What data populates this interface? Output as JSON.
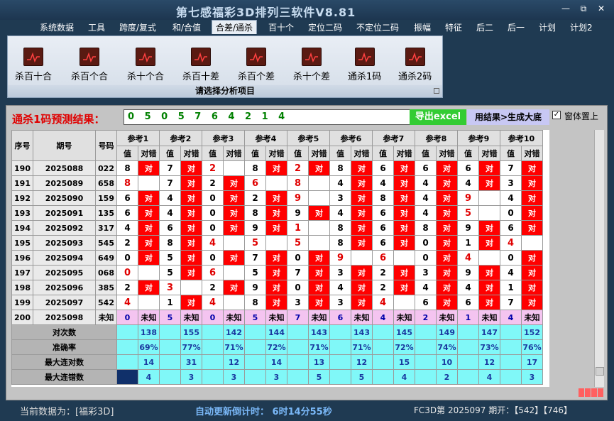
{
  "window": {
    "title": "第七感福彩3D排列三软件V8.81",
    "minimize": "—",
    "restore": "⧉",
    "close": "✕"
  },
  "menu": [
    "系统数据",
    "工具",
    "跨度/复式",
    "和/合值",
    "合差/通杀",
    "百十个",
    "定位二码",
    "不定位二码",
    "振幅",
    "特征",
    "后二",
    "后一",
    "计划",
    "计划2"
  ],
  "menu_active": 4,
  "ribbon": {
    "buttons": [
      "杀百十合",
      "杀百个合",
      "杀十个合",
      "杀百十差",
      "杀百个差",
      "杀十个差",
      "通杀1码",
      "通杀2码"
    ],
    "icon": "chart-icon",
    "caption": "请选择分析项目"
  },
  "prediction": {
    "label": "通杀1码预测结果：",
    "value": "0 5 0 5 7 6 4 2 1 4"
  },
  "buttons": {
    "export": "导出excel",
    "generate": "用结果>生成大底",
    "on_top": "窗体置上",
    "on_top_checked": "✓"
  },
  "table": {
    "head_seq": "序号",
    "head_period": "期号",
    "head_number": "号码",
    "refs": [
      "参考1",
      "参考2",
      "参考3",
      "参考4",
      "参考5",
      "参考6",
      "参考7",
      "参考8",
      "参考9",
      "参考10"
    ],
    "sub_value": "值",
    "sub_hit": "对错",
    "hit_word": "对",
    "rows": [
      {
        "seq": "190",
        "period": "2025088",
        "num": "022",
        "vals": [
          "8",
          "7",
          "2",
          "8",
          "2",
          "8",
          "6",
          "6",
          "6",
          "7"
        ],
        "hits": [
          1,
          1,
          0,
          1,
          1,
          1,
          1,
          1,
          1,
          1
        ],
        "red": [
          0,
          0,
          1,
          0,
          1,
          0,
          0,
          0,
          0,
          0
        ]
      },
      {
        "seq": "191",
        "period": "2025089",
        "num": "658",
        "vals": [
          "8",
          "7",
          "2",
          "6",
          "8",
          "4",
          "4",
          "4",
          "4",
          "3"
        ],
        "hits": [
          0,
          1,
          1,
          0,
          0,
          1,
          1,
          1,
          1,
          1
        ],
        "red": [
          1,
          0,
          0,
          1,
          1,
          0,
          0,
          0,
          0,
          0
        ]
      },
      {
        "seq": "192",
        "period": "2025090",
        "num": "159",
        "vals": [
          "6",
          "4",
          "0",
          "2",
          "9",
          "3",
          "8",
          "4",
          "9",
          "4"
        ],
        "hits": [
          1,
          1,
          1,
          1,
          0,
          1,
          1,
          1,
          0,
          1
        ],
        "red": [
          0,
          0,
          0,
          0,
          1,
          0,
          0,
          0,
          1,
          0
        ]
      },
      {
        "seq": "193",
        "period": "2025091",
        "num": "135",
        "vals": [
          "6",
          "4",
          "0",
          "8",
          "9",
          "4",
          "6",
          "4",
          "5",
          "0"
        ],
        "hits": [
          1,
          1,
          1,
          1,
          1,
          1,
          1,
          1,
          0,
          1
        ],
        "red": [
          0,
          0,
          0,
          0,
          0,
          0,
          0,
          0,
          1,
          0
        ]
      },
      {
        "seq": "194",
        "period": "2025092",
        "num": "317",
        "vals": [
          "4",
          "6",
          "0",
          "9",
          "1",
          "8",
          "6",
          "8",
          "9",
          "6"
        ],
        "hits": [
          1,
          1,
          1,
          1,
          0,
          1,
          1,
          1,
          1,
          1
        ],
        "red": [
          0,
          0,
          0,
          0,
          1,
          0,
          0,
          0,
          0,
          0
        ]
      },
      {
        "seq": "195",
        "period": "2025093",
        "num": "545",
        "vals": [
          "2",
          "8",
          "4",
          "5",
          "5",
          "8",
          "6",
          "0",
          "1",
          "4"
        ],
        "hits": [
          1,
          1,
          0,
          0,
          0,
          1,
          1,
          1,
          1,
          0
        ],
        "red": [
          0,
          0,
          1,
          1,
          1,
          0,
          0,
          0,
          0,
          1
        ]
      },
      {
        "seq": "196",
        "period": "2025094",
        "num": "649",
        "vals": [
          "0",
          "5",
          "0",
          "7",
          "0",
          "9",
          "6",
          "0",
          "4",
          "0"
        ],
        "hits": [
          1,
          1,
          1,
          1,
          1,
          0,
          0,
          1,
          0,
          1
        ],
        "red": [
          0,
          0,
          0,
          0,
          0,
          1,
          1,
          0,
          1,
          0
        ]
      },
      {
        "seq": "197",
        "period": "2025095",
        "num": "068",
        "vals": [
          "0",
          "5",
          "6",
          "5",
          "7",
          "3",
          "2",
          "3",
          "9",
          "4"
        ],
        "hits": [
          0,
          1,
          0,
          1,
          1,
          1,
          1,
          1,
          1,
          1
        ],
        "red": [
          1,
          0,
          1,
          0,
          0,
          0,
          0,
          0,
          0,
          0
        ]
      },
      {
        "seq": "198",
        "period": "2025096",
        "num": "385",
        "vals": [
          "2",
          "3",
          "2",
          "9",
          "0",
          "4",
          "2",
          "4",
          "4",
          "1"
        ],
        "hits": [
          1,
          0,
          1,
          1,
          1,
          1,
          1,
          1,
          1,
          1
        ],
        "red": [
          0,
          1,
          0,
          0,
          0,
          0,
          0,
          0,
          0,
          0
        ]
      },
      {
        "seq": "199",
        "period": "2025097",
        "num": "542",
        "vals": [
          "4",
          "1",
          "4",
          "8",
          "3",
          "3",
          "4",
          "6",
          "6",
          "7"
        ],
        "hits": [
          0,
          1,
          0,
          1,
          1,
          1,
          0,
          1,
          1,
          1
        ],
        "red": [
          1,
          0,
          1,
          0,
          0,
          0,
          1,
          0,
          0,
          0
        ]
      }
    ],
    "pending": {
      "seq": "200",
      "period": "2025098",
      "num": "未知",
      "vals": [
        "0",
        "5",
        "0",
        "5",
        "7",
        "6",
        "4",
        "2",
        "1",
        "4"
      ],
      "status": "未知"
    },
    "stats": [
      {
        "label": "对次数",
        "values": [
          "138",
          "155",
          "142",
          "144",
          "143",
          "143",
          "145",
          "149",
          "147",
          "152"
        ]
      },
      {
        "label": "准确率",
        "values": [
          "69%",
          "77%",
          "71%",
          "72%",
          "71%",
          "71%",
          "72%",
          "74%",
          "73%",
          "76%"
        ]
      },
      {
        "label": "最大连对数",
        "values": [
          "14",
          "31",
          "12",
          "14",
          "13",
          "12",
          "15",
          "10",
          "12",
          "17"
        ]
      },
      {
        "label": "最大连错数",
        "values": [
          "4",
          "3",
          "3",
          "3",
          "5",
          "5",
          "4",
          "2",
          "4",
          "3"
        ]
      }
    ]
  },
  "statusbar": {
    "current": "当前数据为：[福彩3D]",
    "countdown": "自动更新倒计时： 6时14分55秒",
    "issue": "FC3D第 2025097 期开：【542】【746】"
  }
}
